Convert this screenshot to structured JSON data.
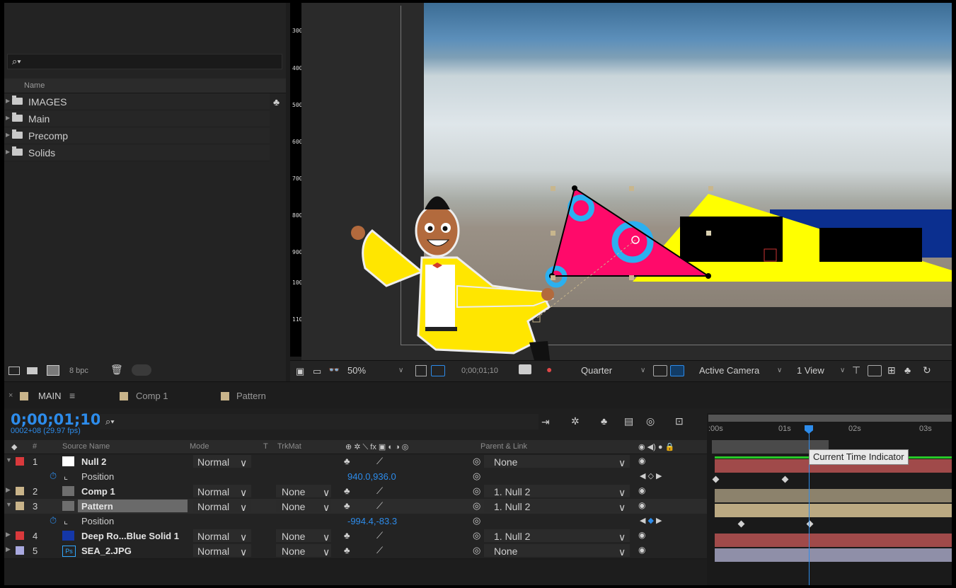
{
  "project": {
    "search_icon": "search-icon",
    "column_name": "Name",
    "folders": [
      {
        "label": "IMAGES"
      },
      {
        "label": "Main"
      },
      {
        "label": "Precomp"
      },
      {
        "label": "Solids"
      }
    ],
    "bpc": "8 bpc"
  },
  "ruler": {
    "ticks": [
      "300",
      "400",
      "500",
      "600",
      "700",
      "800",
      "900",
      "1000",
      "1100"
    ]
  },
  "viewer": {
    "zoom": "50%",
    "timecode": "0;00;01;10",
    "resolution": "Quarter",
    "camera": "Active Camera",
    "views": "1 View"
  },
  "tabs": [
    {
      "label": "MAIN",
      "color": "#c9b48a"
    },
    {
      "label": "Comp 1",
      "color": "#c9b48a"
    },
    {
      "label": "Pattern",
      "color": "#c9b48a"
    }
  ],
  "timeline": {
    "timecode": "0;00;01;10",
    "fps": "0002+08 (29.97 fps)",
    "headers": {
      "source_name": "Source Name",
      "mode": "Mode",
      "t": "T",
      "trkmat": "TrkMat",
      "parent": "Parent & Link",
      "num": "#"
    },
    "layers": [
      {
        "num": "1",
        "name": "Null 2",
        "mode": "Normal",
        "trkmat": "",
        "parent": "None",
        "label_color": "#d9393c",
        "icon_color": "#ffffff"
      },
      {
        "num": "2",
        "name": "Comp 1",
        "mode": "Normal",
        "trkmat": "None",
        "parent": "1. Null 2",
        "label_color": "#c9b48a",
        "icon_color": "#6e6e6e"
      },
      {
        "num": "3",
        "name": "Pattern",
        "mode": "Normal",
        "trkmat": "None",
        "parent": "1. Null 2",
        "label_color": "#c9b48a",
        "icon_color": "#6e6e6e"
      },
      {
        "num": "4",
        "name": "Deep Ro...Blue Solid 1",
        "mode": "Normal",
        "trkmat": "None",
        "parent": "1. Null 2",
        "label_color": "#d9393c",
        "icon_color": "#1437a8"
      },
      {
        "num": "5",
        "name": "SEA_2.JPG",
        "mode": "Normal",
        "trkmat": "None",
        "parent": "None",
        "label_color": "#a9a9e0",
        "icon_color": "#1e5a8c"
      }
    ],
    "properties": [
      {
        "name": "Position",
        "value": "940.0,936.0"
      },
      {
        "name": "Position",
        "value": "-994.4,-83.3"
      }
    ],
    "ruler_labels": [
      ":00s",
      "01s",
      "02s",
      "03s"
    ],
    "tooltip": "Current Time Indicator"
  }
}
